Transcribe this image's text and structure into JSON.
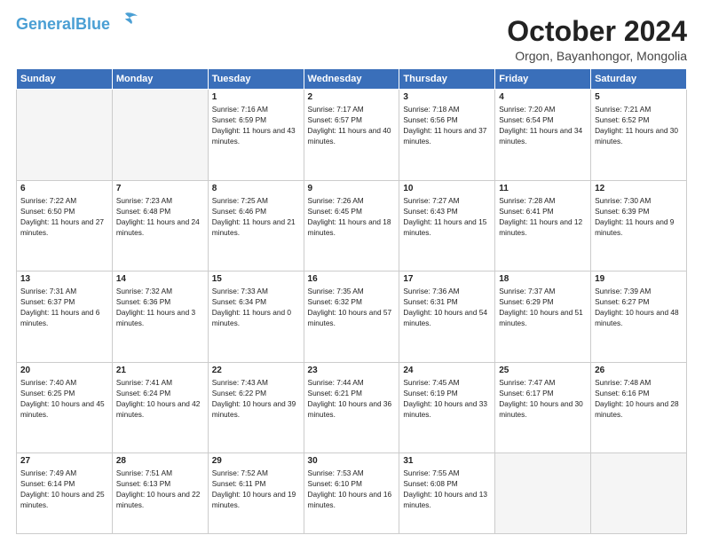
{
  "header": {
    "logo_line1": "General",
    "logo_line2": "Blue",
    "month": "October 2024",
    "location": "Orgon, Bayanhongor, Mongolia"
  },
  "weekdays": [
    "Sunday",
    "Monday",
    "Tuesday",
    "Wednesday",
    "Thursday",
    "Friday",
    "Saturday"
  ],
  "weeks": [
    [
      {
        "day": "",
        "empty": true
      },
      {
        "day": "",
        "empty": true
      },
      {
        "day": "1",
        "sunrise": "7:16 AM",
        "sunset": "6:59 PM",
        "daylight": "11 hours and 43 minutes."
      },
      {
        "day": "2",
        "sunrise": "7:17 AM",
        "sunset": "6:57 PM",
        "daylight": "11 hours and 40 minutes."
      },
      {
        "day": "3",
        "sunrise": "7:18 AM",
        "sunset": "6:56 PM",
        "daylight": "11 hours and 37 minutes."
      },
      {
        "day": "4",
        "sunrise": "7:20 AM",
        "sunset": "6:54 PM",
        "daylight": "11 hours and 34 minutes."
      },
      {
        "day": "5",
        "sunrise": "7:21 AM",
        "sunset": "6:52 PM",
        "daylight": "11 hours and 30 minutes."
      }
    ],
    [
      {
        "day": "6",
        "sunrise": "7:22 AM",
        "sunset": "6:50 PM",
        "daylight": "11 hours and 27 minutes."
      },
      {
        "day": "7",
        "sunrise": "7:23 AM",
        "sunset": "6:48 PM",
        "daylight": "11 hours and 24 minutes."
      },
      {
        "day": "8",
        "sunrise": "7:25 AM",
        "sunset": "6:46 PM",
        "daylight": "11 hours and 21 minutes."
      },
      {
        "day": "9",
        "sunrise": "7:26 AM",
        "sunset": "6:45 PM",
        "daylight": "11 hours and 18 minutes."
      },
      {
        "day": "10",
        "sunrise": "7:27 AM",
        "sunset": "6:43 PM",
        "daylight": "11 hours and 15 minutes."
      },
      {
        "day": "11",
        "sunrise": "7:28 AM",
        "sunset": "6:41 PM",
        "daylight": "11 hours and 12 minutes."
      },
      {
        "day": "12",
        "sunrise": "7:30 AM",
        "sunset": "6:39 PM",
        "daylight": "11 hours and 9 minutes."
      }
    ],
    [
      {
        "day": "13",
        "sunrise": "7:31 AM",
        "sunset": "6:37 PM",
        "daylight": "11 hours and 6 minutes."
      },
      {
        "day": "14",
        "sunrise": "7:32 AM",
        "sunset": "6:36 PM",
        "daylight": "11 hours and 3 minutes."
      },
      {
        "day": "15",
        "sunrise": "7:33 AM",
        "sunset": "6:34 PM",
        "daylight": "11 hours and 0 minutes."
      },
      {
        "day": "16",
        "sunrise": "7:35 AM",
        "sunset": "6:32 PM",
        "daylight": "10 hours and 57 minutes."
      },
      {
        "day": "17",
        "sunrise": "7:36 AM",
        "sunset": "6:31 PM",
        "daylight": "10 hours and 54 minutes."
      },
      {
        "day": "18",
        "sunrise": "7:37 AM",
        "sunset": "6:29 PM",
        "daylight": "10 hours and 51 minutes."
      },
      {
        "day": "19",
        "sunrise": "7:39 AM",
        "sunset": "6:27 PM",
        "daylight": "10 hours and 48 minutes."
      }
    ],
    [
      {
        "day": "20",
        "sunrise": "7:40 AM",
        "sunset": "6:25 PM",
        "daylight": "10 hours and 45 minutes."
      },
      {
        "day": "21",
        "sunrise": "7:41 AM",
        "sunset": "6:24 PM",
        "daylight": "10 hours and 42 minutes."
      },
      {
        "day": "22",
        "sunrise": "7:43 AM",
        "sunset": "6:22 PM",
        "daylight": "10 hours and 39 minutes."
      },
      {
        "day": "23",
        "sunrise": "7:44 AM",
        "sunset": "6:21 PM",
        "daylight": "10 hours and 36 minutes."
      },
      {
        "day": "24",
        "sunrise": "7:45 AM",
        "sunset": "6:19 PM",
        "daylight": "10 hours and 33 minutes."
      },
      {
        "day": "25",
        "sunrise": "7:47 AM",
        "sunset": "6:17 PM",
        "daylight": "10 hours and 30 minutes."
      },
      {
        "day": "26",
        "sunrise": "7:48 AM",
        "sunset": "6:16 PM",
        "daylight": "10 hours and 28 minutes."
      }
    ],
    [
      {
        "day": "27",
        "sunrise": "7:49 AM",
        "sunset": "6:14 PM",
        "daylight": "10 hours and 25 minutes."
      },
      {
        "day": "28",
        "sunrise": "7:51 AM",
        "sunset": "6:13 PM",
        "daylight": "10 hours and 22 minutes."
      },
      {
        "day": "29",
        "sunrise": "7:52 AM",
        "sunset": "6:11 PM",
        "daylight": "10 hours and 19 minutes."
      },
      {
        "day": "30",
        "sunrise": "7:53 AM",
        "sunset": "6:10 PM",
        "daylight": "10 hours and 16 minutes."
      },
      {
        "day": "31",
        "sunrise": "7:55 AM",
        "sunset": "6:08 PM",
        "daylight": "10 hours and 13 minutes."
      },
      {
        "day": "",
        "empty": true
      },
      {
        "day": "",
        "empty": true
      }
    ]
  ]
}
